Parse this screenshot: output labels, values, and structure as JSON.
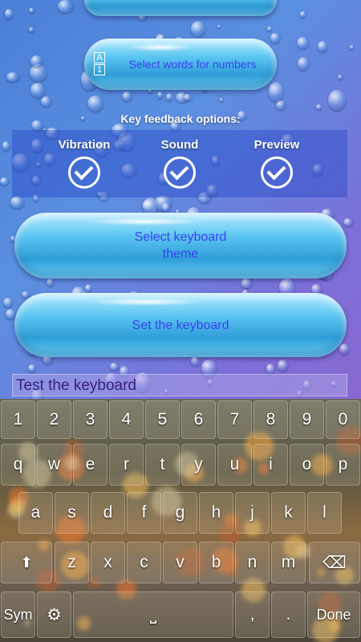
{
  "settings": {
    "numbers_button": "Select words for numbers",
    "num_icon_top": "A",
    "num_icon_bottom": "1",
    "feedback_title": "Key feedback options:",
    "feedback_options": [
      "Vibration",
      "Sound",
      "Preview"
    ],
    "theme_button": "Select keyboard theme",
    "set_button": "Set the keyboard"
  },
  "test_field": {
    "value": "Test the keyboard"
  },
  "keyboard": {
    "row_numbers": [
      "1",
      "2",
      "3",
      "4",
      "5",
      "6",
      "7",
      "8",
      "9",
      "0"
    ],
    "row1": [
      "q",
      "w",
      "e",
      "r",
      "t",
      "y",
      "u",
      "i",
      "o",
      "p"
    ],
    "row2": [
      "a",
      "s",
      "d",
      "f",
      "g",
      "h",
      "j",
      "k",
      "l"
    ],
    "row3": [
      "z",
      "x",
      "c",
      "v",
      "b",
      "n",
      "m"
    ],
    "shift": "⬆",
    "backspace": "⌫",
    "sym": "Sym",
    "settings_icon": "⚙",
    "space": "⎵",
    "comma": ",",
    "period": ".",
    "done": "Done"
  },
  "icons": {
    "check": "check-circle-icon",
    "shift": "shift-icon",
    "backspace": "backspace-icon",
    "gear": "gear-icon"
  }
}
